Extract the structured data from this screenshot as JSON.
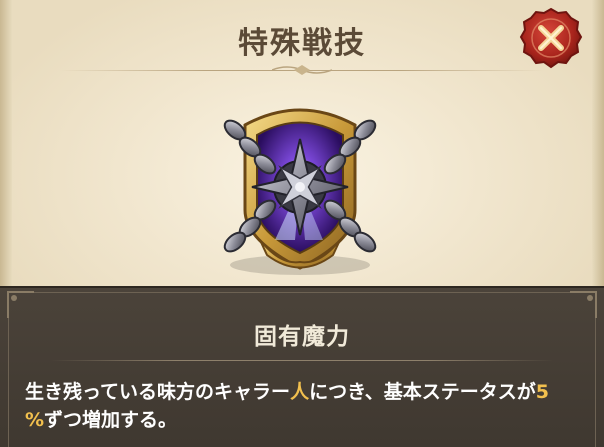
{
  "dialog": {
    "title": "特殊戦技",
    "close_label": "close"
  },
  "skill": {
    "name": "固有魔力",
    "description_parts": [
      "生き残っている味方のキャラー",
      "人",
      "につき、基本ステータスが",
      "5",
      "%",
      "ずつ増加する。"
    ]
  },
  "colors": {
    "panel_bg": "#efe5cf",
    "bottom_bg": "#443c33",
    "title_text": "#5b4a37",
    "highlight": "#f2c04e",
    "close_button": "#b52a21"
  },
  "icons": {
    "close": "close-x-icon",
    "emblem": "chained-star-emblem-icon"
  }
}
